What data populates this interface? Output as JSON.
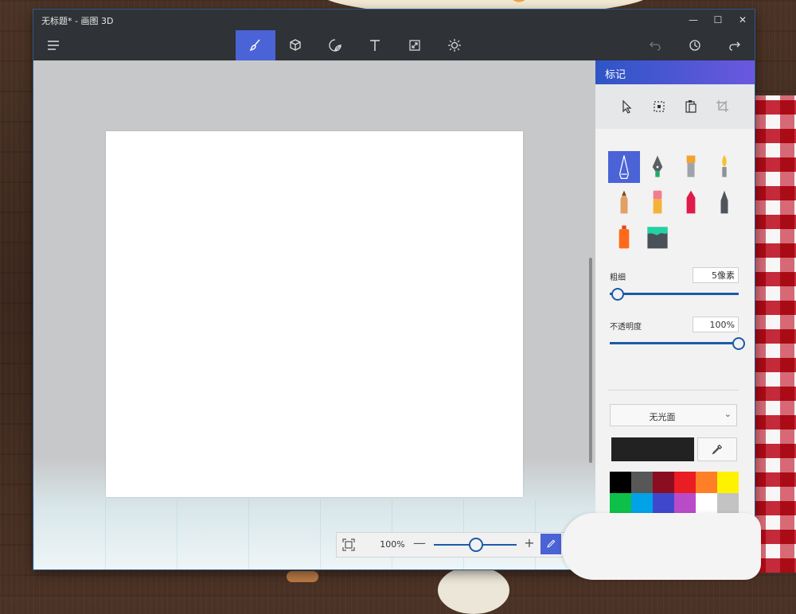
{
  "window": {
    "title": "无标题* - 画图 3D",
    "minimize": "—",
    "maximize": "☐",
    "close": "✕"
  },
  "toolbar": {
    "menu_icon": "hamburger-icon",
    "tabs": [
      {
        "name": "brushes",
        "icon": "brush-icon",
        "active": true
      },
      {
        "name": "3d-shapes",
        "icon": "cube-icon",
        "active": false
      },
      {
        "name": "stickers",
        "icon": "sticker-icon",
        "active": false
      },
      {
        "name": "text",
        "icon": "text-icon",
        "active": false
      },
      {
        "name": "canvas",
        "icon": "resize-icon",
        "active": false
      },
      {
        "name": "effects",
        "icon": "sun-icon",
        "active": false
      }
    ],
    "undo_icon": "undo-icon",
    "history_icon": "history-icon",
    "redo_icon": "redo-icon",
    "accent": "#4a63d6"
  },
  "panel": {
    "title": "标记",
    "thickness_label": "粗细",
    "thickness_value": "5像素",
    "thickness_fraction": 0.05,
    "opacity_label": "不透明度",
    "opacity_value": "100%",
    "opacity_fraction": 1.0,
    "finish_value": "无光面",
    "current_color": "#222222",
    "palette": [
      "#000000",
      "#575757",
      "#8b0e20",
      "#ea1c24",
      "#ff7f27",
      "#fff200",
      "#0ec04a",
      "#00a2e8",
      "#3f48cc",
      "#b94bc9",
      "#ffffff",
      "#c3c3c3",
      "#b97a57",
      "#ffaec9",
      "#ffc90e",
      "#efe4b0",
      "#b5e61d",
      "#99d9ea"
    ]
  },
  "zoom": {
    "value": "100%",
    "minus": "—",
    "plus": "+",
    "fraction": 0.5
  }
}
